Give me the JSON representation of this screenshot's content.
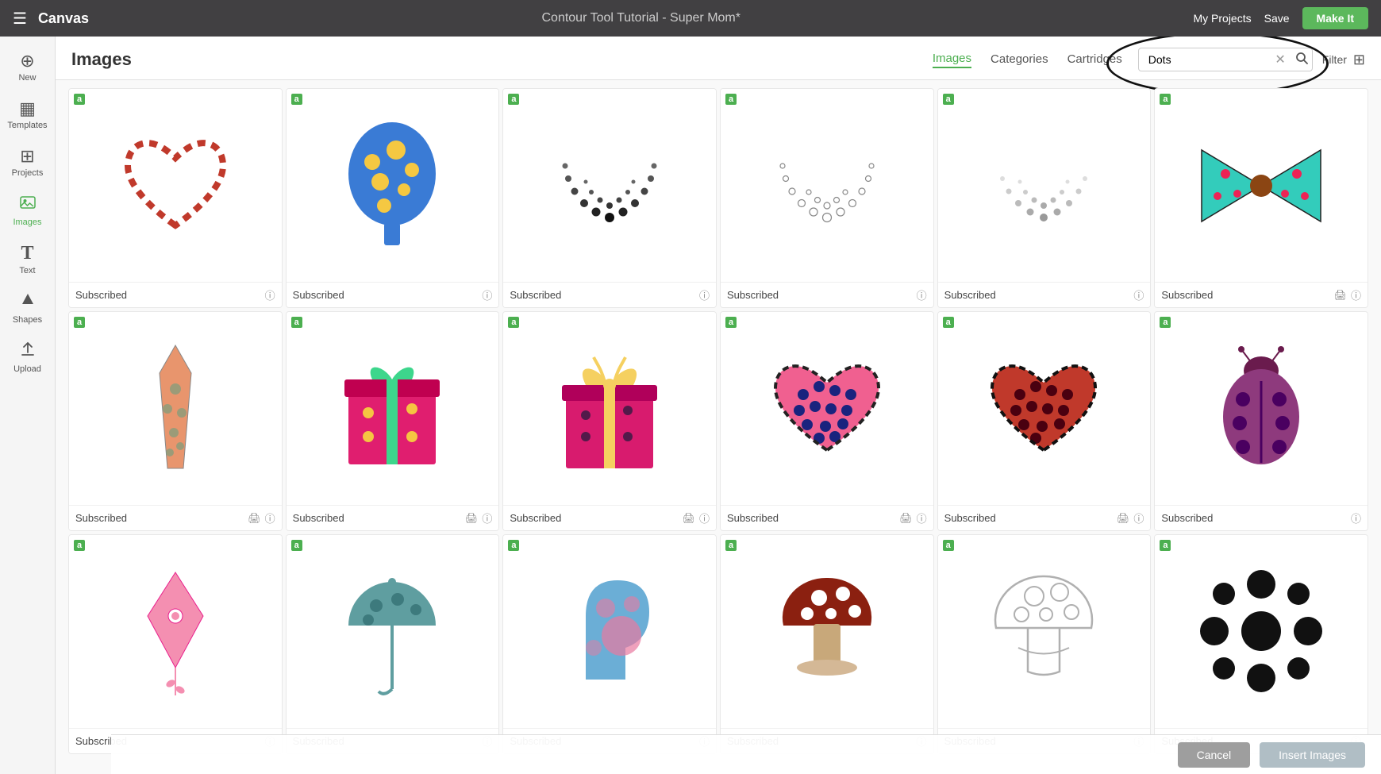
{
  "topbar": {
    "menu_icon": "☰",
    "canvas_label": "Canvas",
    "center_title": "Contour Tool Tutorial - Super Mom*",
    "my_projects": "My Projects",
    "save": "Save",
    "make_it": "Make It"
  },
  "sidebar": {
    "items": [
      {
        "id": "new",
        "icon": "⊕",
        "label": "New"
      },
      {
        "id": "templates",
        "icon": "▦",
        "label": "Templates"
      },
      {
        "id": "projects",
        "icon": "⊞",
        "label": "Projects"
      },
      {
        "id": "images",
        "icon": "🖼",
        "label": "Images"
      },
      {
        "id": "text",
        "icon": "T",
        "label": "Text"
      },
      {
        "id": "shapes",
        "icon": "✦",
        "label": "Shapes"
      },
      {
        "id": "upload",
        "icon": "↑",
        "label": "Upload"
      }
    ]
  },
  "panel": {
    "title": "Images",
    "tabs": [
      {
        "id": "images",
        "label": "Images",
        "active": true
      },
      {
        "id": "categories",
        "label": "Categories",
        "active": false
      },
      {
        "id": "cartridges",
        "label": "Cartridges",
        "active": false
      }
    ],
    "search_value": "Dots",
    "search_placeholder": "Search",
    "filter_label": "Filter",
    "badge_label": "a"
  },
  "grid": {
    "items": [
      {
        "id": 1,
        "label": "Subscribed",
        "has_print": false,
        "shape": "heart_dashed_red"
      },
      {
        "id": 2,
        "label": "Subscribed",
        "has_print": false,
        "shape": "balloon_dots"
      },
      {
        "id": 3,
        "label": "Subscribed",
        "has_print": false,
        "shape": "dots_arc_black"
      },
      {
        "id": 4,
        "label": "Subscribed",
        "has_print": false,
        "shape": "dots_arc_outline"
      },
      {
        "id": 5,
        "label": "Subscribed",
        "has_print": false,
        "shape": "dots_arc_grey"
      },
      {
        "id": 6,
        "label": "Subscribed",
        "has_print": true,
        "shape": "bow_polka"
      },
      {
        "id": 7,
        "label": "Subscribed",
        "has_print": true,
        "shape": "tie_polka"
      },
      {
        "id": 8,
        "label": "Subscribed",
        "has_print": true,
        "shape": "gift_polka"
      },
      {
        "id": 9,
        "label": "Subscribed",
        "has_print": true,
        "shape": "gift_bow_polka"
      },
      {
        "id": 10,
        "label": "Subscribed",
        "has_print": true,
        "shape": "heart_polka_pink"
      },
      {
        "id": 11,
        "label": "Subscribed",
        "has_print": true,
        "shape": "heart_polka_red"
      },
      {
        "id": 12,
        "label": "Subscribed",
        "has_print": false,
        "shape": "ladybug_purple"
      },
      {
        "id": 13,
        "label": "Subscribed",
        "has_print": false,
        "shape": "diamond_pink"
      },
      {
        "id": 14,
        "label": "Subscribed",
        "has_print": false,
        "shape": "umbrella_teal"
      },
      {
        "id": 15,
        "label": "Subscribed",
        "has_print": false,
        "shape": "elephant_blue"
      },
      {
        "id": 16,
        "label": "Subscribed",
        "has_print": false,
        "shape": "mushroom_red"
      },
      {
        "id": 17,
        "label": "Subscribed",
        "has_print": false,
        "shape": "mushroom_outline"
      },
      {
        "id": 18,
        "label": "Subscribed",
        "has_print": false,
        "shape": "circle_dots_black"
      }
    ]
  },
  "bottom": {
    "cancel_label": "Cancel",
    "insert_label": "Insert Images"
  }
}
